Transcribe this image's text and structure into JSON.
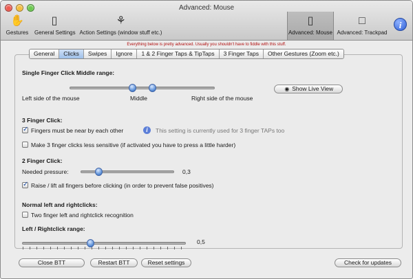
{
  "window": {
    "title": "Advanced: Mouse"
  },
  "toolbar": {
    "items": [
      {
        "label": "Gestures",
        "icon": "hand-icon"
      },
      {
        "label": "General Settings",
        "icon": "switch-icon"
      },
      {
        "label": "Action Settings (window stuff etc.)",
        "icon": "wand-icon"
      },
      {
        "label": "Advanced: Mouse",
        "icon": "mouse-icon"
      },
      {
        "label": "Advanced: Trackpad",
        "icon": "trackpad-icon"
      }
    ]
  },
  "warning": "Everything below is pretty advanced. Usually you shouldn't have to fiddle with this stuff.",
  "tabs": [
    {
      "label": "General"
    },
    {
      "label": "Clicks"
    },
    {
      "label": "Swipes"
    },
    {
      "label": "Ignore"
    },
    {
      "label": "1 & 2 Finger Taps & TipTaps"
    },
    {
      "label": "3 Finger Taps"
    },
    {
      "label": "Other Gestures (Zoom etc.)"
    }
  ],
  "single_finger": {
    "heading": "Single Finger Click Middle range:",
    "left_label": "Left side of the mouse",
    "middle_label": "Middle",
    "right_label": "Right side of the mouse",
    "live_view_button": "Show Live View",
    "range_start": 0.34,
    "range_end": 0.48
  },
  "three_finger": {
    "heading": "3 Finger Click:",
    "near_label": "Fingers must be near by each other",
    "near_checked": true,
    "info_note": "This setting is currently used for 3 finger TAPs too",
    "less_sensitive_label": "Make 3 finger clicks less sensitive (if activated you have to press a little harder)",
    "less_sensitive_checked": false
  },
  "two_finger": {
    "heading": "2 Finger Click:",
    "pressure_label": "Needed pressure:",
    "pressure_value": "0,3",
    "raise_label": "Raise / lift all fingers before clicking (in order to prevent false positives)",
    "raise_checked": true
  },
  "normal_clicks": {
    "heading": "Normal left and rightclicks:",
    "two_finger_recognition_label": "Two finger left and rightclick recognition",
    "two_finger_recognition_checked": false,
    "range_heading": "Left / Rightclick range:",
    "range_value": "0,5"
  },
  "footer": {
    "close": "Close BTT",
    "restart": "Restart BTT",
    "reset": "Reset settings",
    "check_updates": "Check for updates"
  }
}
